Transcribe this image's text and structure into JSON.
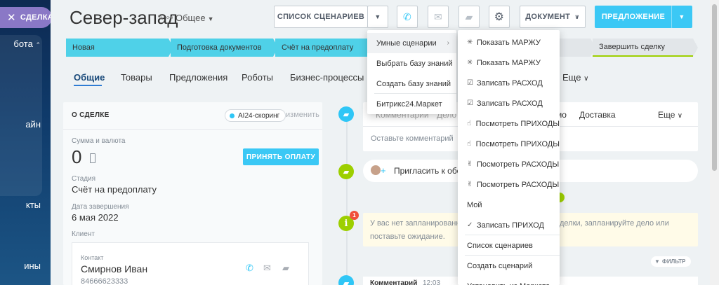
{
  "sidebar": {
    "close_label": "СДЕЛКА",
    "items": [
      "бота",
      "айн",
      "кты",
      "ины"
    ]
  },
  "header": {
    "title": "Север-запад",
    "category": "Общее",
    "scenarios_label": "СПИСОК СЦЕНАРИЕВ",
    "document_label": "ДОКУМЕНТ",
    "offer_label": "ПРЕДЛОЖЕНИЕ"
  },
  "stages": [
    {
      "label": "Новая"
    },
    {
      "label": "Подготовка документов"
    },
    {
      "label": "Счёт на предоплату"
    },
    {
      "label": ""
    },
    {
      "label": "Завершить сделку"
    }
  ],
  "tabs": [
    {
      "label": "Общие"
    },
    {
      "label": "Товары"
    },
    {
      "label": "Предложения"
    },
    {
      "label": "Роботы"
    },
    {
      "label": "Бизнес-процессы"
    },
    {
      "label": "Еще"
    }
  ],
  "deal_card": {
    "title": "О СДЕЛКЕ",
    "ai_label": "AI24-скоринг",
    "change_label": "изменить",
    "sum_label": "Сумма и валюта",
    "sum_value": "0",
    "pay_button": "ПРИНЯТЬ ОПЛАТУ",
    "stage_label": "Стадия",
    "stage_value": "Счёт на предоплату",
    "date_label": "Дата завершения",
    "date_value": "6 мая 2022",
    "client_label": "Клиент",
    "contact_label": "Контакт",
    "contact_name": "Смирнов Иван",
    "contact_phone": "84666623333"
  },
  "timeline": {
    "tabs": [
      "Комментарий",
      "Дело",
      "мо",
      "Доставка",
      "Еще"
    ],
    "comment_placeholder": "Оставьте комментарий",
    "invite_text": "Пригласить к обсу",
    "info_line1": "У вас нет запланированн",
    "info_line1b": "делки, запланируйте дело или",
    "info_line2": "поставьте ожидание.",
    "info_badge": "1",
    "filter_label": "ФИЛЬТР",
    "last_item": "Комментарий",
    "last_time": "12:03"
  },
  "menu_main": [
    {
      "label": "Умные сценарии",
      "has_sub": true,
      "selected": true
    },
    {
      "label": "Выбрать базу знаний"
    },
    {
      "label": "Создать базу знаний"
    },
    {
      "label": "Битрикс24.Маркет"
    }
  ],
  "menu_sub": [
    {
      "icon": "✳",
      "label": "Показать МАРЖУ"
    },
    {
      "icon": "✳",
      "label": "Показать МАРЖУ"
    },
    {
      "icon": "☑",
      "label": "Записать РАСХОД"
    },
    {
      "icon": "☑",
      "label": "Записать РАСХОД"
    },
    {
      "icon": "☝",
      "label": "Посмотреть ПРИХОДЫ"
    },
    {
      "icon": "☝",
      "label": "Посмотреть ПРИХОДЫ"
    },
    {
      "icon": "✌",
      "label": "Посмотреть РАСХОДЫ"
    },
    {
      "icon": "✌",
      "label": "Посмотреть РАСХОДЫ"
    },
    {
      "icon": "",
      "label": "Мой"
    },
    {
      "icon": "✓",
      "label": "Записать ПРИХОД"
    },
    {
      "icon": "",
      "label": "Список сценариев"
    },
    {
      "icon": "",
      "label": "Создать сценарий"
    },
    {
      "icon": "",
      "label": "Установить из Маркета"
    }
  ],
  "colors": {
    "accent": "#3bc8f5",
    "stage_active": "#4fd1e8",
    "success": "#9dcf00",
    "alert": "#f0503c",
    "sidebar": "#0f3a6a"
  }
}
